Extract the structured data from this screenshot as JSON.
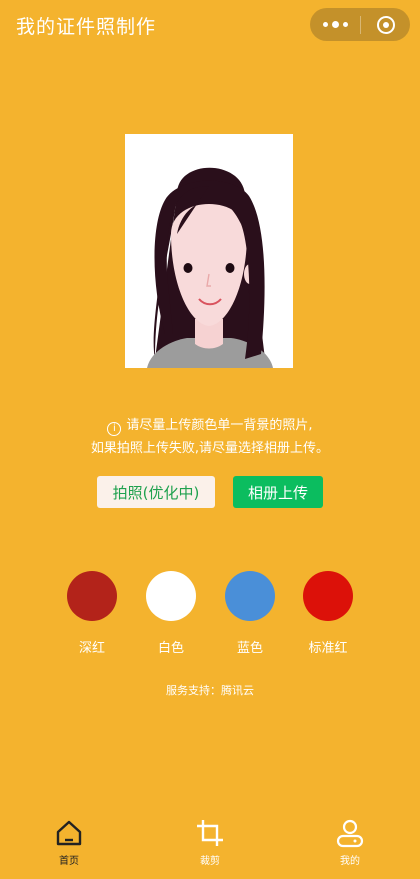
{
  "header": {
    "title": "我的证件照制作",
    "capsule": {
      "more_icon": "more-dots-icon",
      "close_icon": "target-icon"
    }
  },
  "preview": {
    "description_icon": "avatar-illustration"
  },
  "tips": {
    "line1": "请尽量上传颜色单一背景的照片,",
    "line2": "如果拍照上传失败,请尽量选择相册上传。",
    "icon": "info-icon",
    "icon_glyph": "i"
  },
  "buttons": {
    "take_photo": "拍照(优化中)",
    "album_upload": "相册上传"
  },
  "backgrounds": [
    {
      "label": "深红",
      "color": "#B3231A"
    },
    {
      "label": "白色",
      "color": "#FFFFFF"
    },
    {
      "label": "蓝色",
      "color": "#4A8FD8"
    },
    {
      "label": "标准红",
      "color": "#DC1109"
    }
  ],
  "support": "服务支持：腾讯云",
  "tabbar": {
    "items": [
      {
        "label": "首页",
        "icon": "home-icon",
        "active": true
      },
      {
        "label": "裁剪",
        "icon": "crop-icon",
        "active": false
      },
      {
        "label": "我的",
        "icon": "user-icon",
        "active": false
      }
    ]
  },
  "colors": {
    "background": "#F4B32E",
    "accent_green": "#0BBD5F",
    "capsule": "#C4912A"
  }
}
